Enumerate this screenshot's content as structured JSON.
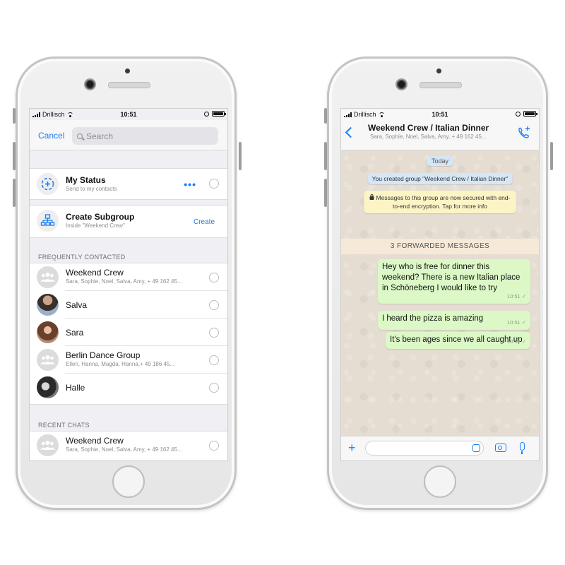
{
  "left_phone": {
    "status_bar": {
      "carrier": "Drillisch",
      "time": "10:51"
    },
    "nav": {
      "cancel_label": "Cancel",
      "search_placeholder": "Search"
    },
    "my_status": {
      "name": "My Status",
      "subtitle": "Send to my contacts",
      "more_label": "•••"
    },
    "subgroup": {
      "name": "Create Subgroup",
      "subtitle": "Inside \"Weekend Crew\"",
      "action_label": "Create"
    },
    "frequently_contacted": {
      "heading": "FREQUENTLY CONTACTED",
      "items": [
        {
          "name": "Weekend Crew",
          "subtitle": "Sara, Sophie, Noel, Salva, Amy, + 49 162 45...",
          "avatar": "group-icon"
        },
        {
          "name": "Salva",
          "subtitle": "",
          "avatar": "photo"
        },
        {
          "name": "Sara",
          "subtitle": "",
          "avatar": "photo"
        },
        {
          "name": "Berlin Dance Group",
          "subtitle": "Ellen, Hanna, Magda, Hanna,+ 49 186 45...",
          "avatar": "group-icon"
        },
        {
          "name": "Halle",
          "subtitle": "",
          "avatar": "photo"
        }
      ]
    },
    "recent_chats": {
      "heading": "RECENT CHATS",
      "items": [
        {
          "name": "Weekend Crew",
          "subtitle": "Sara, Sophie, Noel, Salva, Amy, + 49 162 45...",
          "avatar": "group-icon"
        }
      ]
    }
  },
  "right_phone": {
    "status_bar": {
      "carrier": "Drillisch",
      "time": "10:51"
    },
    "header": {
      "title": "Weekend Crew / Italian Dinner",
      "subtitle": "Sara, Sophie, Noel, Salva, Amy, + 49 162 45..."
    },
    "system": {
      "date_label": "Today",
      "created": "You created group \"Weekend Crew / Italian Dinner\"",
      "encryption": "Messages to this group are now secured with end-to-end encryption. Tap for more info"
    },
    "forwarded_banner": "3 FORWARDED MESSAGES",
    "messages": [
      {
        "text": "Hey who is free for dinner this weekend? There is a new Italian place in Schöneberg I would like to try",
        "time": "10:51"
      },
      {
        "text": "I heard the pizza is amazing",
        "time": "10:51"
      },
      {
        "text": "It's been ages since we all caught up",
        "time": "10:51"
      }
    ],
    "colors": {
      "accent": "#1a7cf6",
      "outgoing_bubble": "#dcf8c6",
      "chat_background": "#e5ddd2"
    }
  }
}
